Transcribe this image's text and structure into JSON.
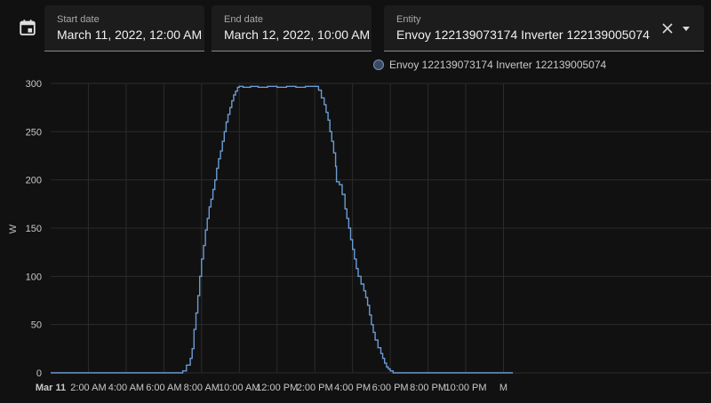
{
  "controls": {
    "start": {
      "label": "Start date",
      "value": "March 11, 2022, 12:00 AM"
    },
    "end": {
      "label": "End date",
      "value": "March 12, 2022, 10:00 AM"
    },
    "entity": {
      "label": "Entity",
      "value": "Envoy 122139073174 Inverter 122139005074"
    }
  },
  "colors": {
    "background": "#111111",
    "series": "#6b9bd2",
    "grid": "#2c2c2c"
  },
  "chart_data": {
    "type": "line",
    "ylabel": "W",
    "ylim": [
      0,
      300
    ],
    "yticks": [
      0,
      50,
      100,
      150,
      200,
      250,
      300
    ],
    "grid": true,
    "legend_position": "top",
    "xlim_hours": [
      0,
      35
    ],
    "xticks": [
      {
        "hour": 0,
        "label": "Mar 11"
      },
      {
        "hour": 2,
        "label": "2:00 AM"
      },
      {
        "hour": 4,
        "label": "4:00 AM"
      },
      {
        "hour": 6,
        "label": "6:00 AM"
      },
      {
        "hour": 8,
        "label": "8:00 AM"
      },
      {
        "hour": 10,
        "label": "10:00 AM"
      },
      {
        "hour": 12,
        "label": "12:00 PM"
      },
      {
        "hour": 14,
        "label": "2:00 PM"
      },
      {
        "hour": 16,
        "label": "4:00 PM"
      },
      {
        "hour": 18,
        "label": "6:00 PM"
      },
      {
        "hour": 20,
        "label": "8:00 PM"
      },
      {
        "hour": 22,
        "label": "10:00 PM"
      },
      {
        "hour": 24,
        "label": "M"
      }
    ],
    "series": [
      {
        "name": "Envoy 122139073174 Inverter 122139005074",
        "step": true,
        "points": [
          [
            0,
            0
          ],
          [
            6.8,
            0
          ],
          [
            7.0,
            2
          ],
          [
            7.2,
            8
          ],
          [
            7.4,
            15
          ],
          [
            7.5,
            25
          ],
          [
            7.6,
            45
          ],
          [
            7.7,
            62
          ],
          [
            7.8,
            80
          ],
          [
            7.9,
            100
          ],
          [
            8.0,
            118
          ],
          [
            8.1,
            132
          ],
          [
            8.2,
            148
          ],
          [
            8.3,
            160
          ],
          [
            8.4,
            172
          ],
          [
            8.5,
            180
          ],
          [
            8.6,
            190
          ],
          [
            8.7,
            200
          ],
          [
            8.8,
            212
          ],
          [
            8.9,
            222
          ],
          [
            9.0,
            230
          ],
          [
            9.1,
            240
          ],
          [
            9.2,
            250
          ],
          [
            9.3,
            260
          ],
          [
            9.4,
            268
          ],
          [
            9.5,
            275
          ],
          [
            9.6,
            282
          ],
          [
            9.7,
            288
          ],
          [
            9.8,
            292
          ],
          [
            9.9,
            296
          ],
          [
            10.0,
            297
          ],
          [
            10.2,
            296
          ],
          [
            10.6,
            297
          ],
          [
            11.0,
            296
          ],
          [
            11.5,
            297
          ],
          [
            12.0,
            296
          ],
          [
            12.5,
            297
          ],
          [
            13.0,
            296
          ],
          [
            13.5,
            297
          ],
          [
            14.0,
            297
          ],
          [
            14.2,
            293
          ],
          [
            14.35,
            285
          ],
          [
            14.5,
            278
          ],
          [
            14.6,
            270
          ],
          [
            14.7,
            262
          ],
          [
            14.8,
            250
          ],
          [
            14.9,
            240
          ],
          [
            15.0,
            228
          ],
          [
            15.1,
            214
          ],
          [
            15.15,
            198
          ],
          [
            15.3,
            195
          ],
          [
            15.45,
            185
          ],
          [
            15.6,
            170
          ],
          [
            15.7,
            160
          ],
          [
            15.8,
            150
          ],
          [
            15.9,
            138
          ],
          [
            16.0,
            128
          ],
          [
            16.1,
            118
          ],
          [
            16.2,
            108
          ],
          [
            16.3,
            100
          ],
          [
            16.45,
            92
          ],
          [
            16.6,
            85
          ],
          [
            16.7,
            78
          ],
          [
            16.8,
            70
          ],
          [
            16.9,
            60
          ],
          [
            17.0,
            50
          ],
          [
            17.1,
            42
          ],
          [
            17.2,
            34
          ],
          [
            17.35,
            26
          ],
          [
            17.5,
            20
          ],
          [
            17.6,
            15
          ],
          [
            17.7,
            10
          ],
          [
            17.8,
            6
          ],
          [
            17.9,
            4
          ],
          [
            18.0,
            2
          ],
          [
            18.15,
            0
          ],
          [
            24.5,
            0
          ]
        ]
      }
    ]
  }
}
